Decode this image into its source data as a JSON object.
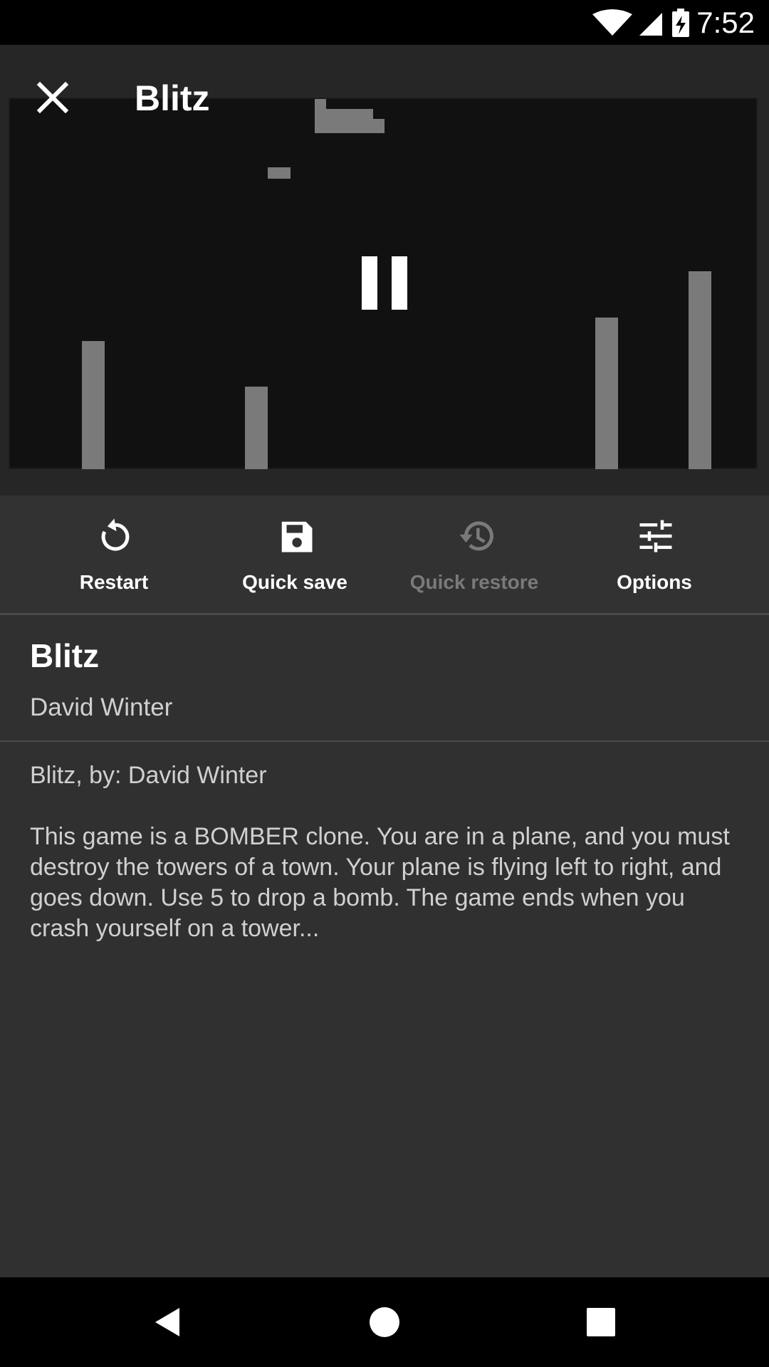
{
  "status_bar": {
    "time": "7:52",
    "icons": [
      "wifi-icon",
      "cell-signal-icon",
      "battery-charging-icon"
    ]
  },
  "header": {
    "title": "Blitz",
    "close_icon": "close-icon"
  },
  "game_screen": {
    "state_icon": "pause-icon",
    "colors": {
      "background": "#111111",
      "pixels": "#7a7a7a"
    }
  },
  "toolbar": {
    "restart": {
      "label": "Restart",
      "icon": "restart-icon",
      "enabled": true
    },
    "quick_save": {
      "label": "Quick save",
      "icon": "save-icon",
      "enabled": true
    },
    "quick_restore": {
      "label": "Quick restore",
      "icon": "history-icon",
      "enabled": false
    },
    "options": {
      "label": "Options",
      "icon": "tune-icon",
      "enabled": true
    }
  },
  "info": {
    "name": "Blitz",
    "author": "David Winter"
  },
  "description": {
    "line1": "Blitz, by: David Winter",
    "body": "This game is a BOMBER clone. You are in a plane, and you must destroy the towers of a town. Your plane is flying left to right, and goes down. Use 5 to drop a bomb. The game ends when you crash yourself on a tower..."
  },
  "nav_bar": {
    "buttons": [
      "back-icon",
      "home-icon",
      "recents-icon"
    ]
  }
}
